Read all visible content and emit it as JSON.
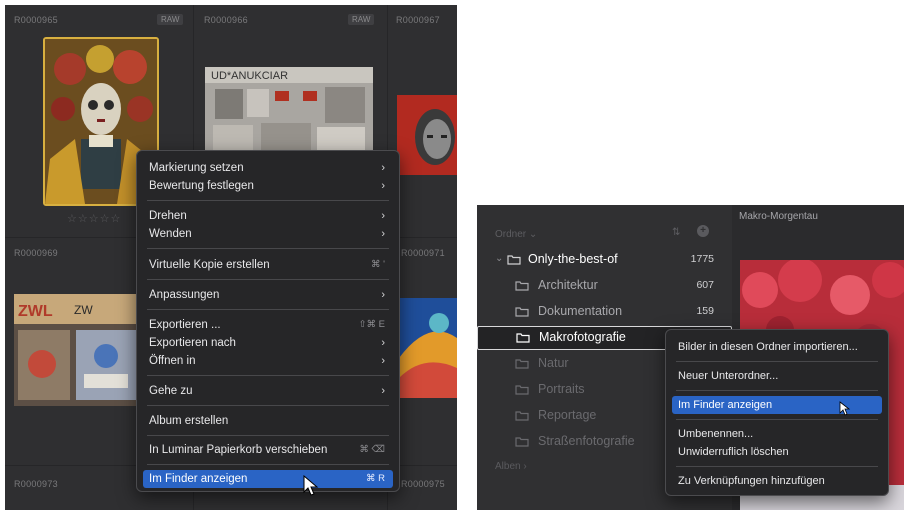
{
  "gallery": {
    "cells": [
      {
        "label": "R0000965",
        "badge": "RAW"
      },
      {
        "label": "R0000966",
        "badge": "RAW"
      },
      {
        "label": "R0000967",
        "badge": ""
      },
      {
        "label": "R0000969",
        "badge": ""
      },
      {
        "label": "R0000971",
        "badge": ""
      },
      {
        "label": "R0000973",
        "badge": ""
      },
      {
        "label": "R0000975",
        "badge": ""
      }
    ],
    "stars": "☆☆☆☆☆"
  },
  "context_menu": {
    "items": [
      {
        "label": "Markierung setzen",
        "arrow": "›",
        "shortcut": ""
      },
      {
        "label": "Bewertung festlegen",
        "arrow": "›",
        "shortcut": ""
      },
      {
        "label": "Drehen",
        "arrow": "›",
        "shortcut": ""
      },
      {
        "label": "Wenden",
        "arrow": "›",
        "shortcut": ""
      },
      {
        "label": "Virtuelle Kopie erstellen",
        "arrow": "",
        "shortcut": "⌘ '"
      },
      {
        "label": "Anpassungen",
        "arrow": "›",
        "shortcut": ""
      },
      {
        "label": "Exportieren ...",
        "arrow": "",
        "shortcut": "⇧⌘ E"
      },
      {
        "label": "Exportieren nach",
        "arrow": "›",
        "shortcut": ""
      },
      {
        "label": "Öffnen in",
        "arrow": "›",
        "shortcut": ""
      },
      {
        "label": "Gehe zu",
        "arrow": "›",
        "shortcut": ""
      },
      {
        "label": "Album erstellen",
        "arrow": "",
        "shortcut": ""
      },
      {
        "label": "In Luminar Papierkorb verschieben",
        "arrow": "",
        "shortcut": "⌘ ⌫"
      },
      {
        "label": "Im Finder anzeigen",
        "arrow": "",
        "shortcut": "⌘ R"
      }
    ]
  },
  "folders_panel": {
    "header": "Ordner ⌄",
    "folders": [
      {
        "name": "Only-the-best-of",
        "count": "1775",
        "caret": "⌄"
      },
      {
        "name": "Architektur",
        "count": "607",
        "caret": ""
      },
      {
        "name": "Dokumentation",
        "count": "159",
        "caret": ""
      },
      {
        "name": "Makrofotografie",
        "count": "",
        "caret": ""
      },
      {
        "name": "Natur",
        "count": "",
        "caret": ""
      },
      {
        "name": "Portraits",
        "count": "",
        "caret": ""
      },
      {
        "name": "Reportage",
        "count": "",
        "caret": ""
      },
      {
        "name": "Straßenfotografie",
        "count": "",
        "caret": ""
      }
    ],
    "footer": "Alben ›",
    "preview_title": "Makro-Morgentau"
  },
  "folder_menu": {
    "items": [
      {
        "label": "Bilder in diesen Ordner importieren..."
      },
      {
        "label": "Neuer Unterordner..."
      },
      {
        "label": "Im Finder anzeigen"
      },
      {
        "label": "Umbenennen..."
      },
      {
        "label": "Unwiderruflich löschen"
      },
      {
        "label": "Zu Verknüpfungen hinzufügen"
      }
    ]
  },
  "colors": {
    "accent": "#2a64c5",
    "panel_bg": "#2f2f31",
    "menu_bg": "#262628"
  }
}
